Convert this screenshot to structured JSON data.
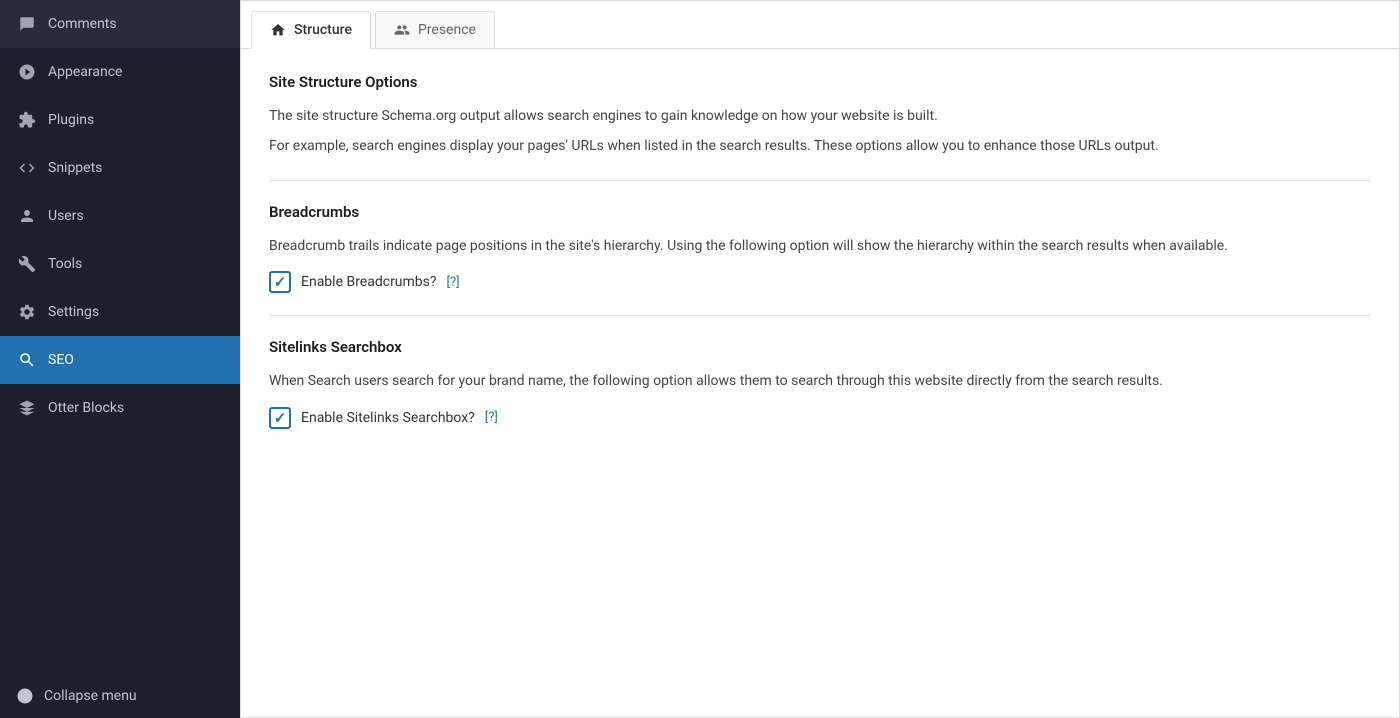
{
  "sidebar": {
    "items": [
      {
        "id": "comments",
        "label": "Comments",
        "icon": "comment"
      },
      {
        "id": "appearance",
        "label": "Appearance",
        "icon": "appearance"
      },
      {
        "id": "plugins",
        "label": "Plugins",
        "icon": "plugin"
      },
      {
        "id": "snippets",
        "label": "Snippets",
        "icon": "snippets"
      },
      {
        "id": "users",
        "label": "Users",
        "icon": "users"
      },
      {
        "id": "tools",
        "label": "Tools",
        "icon": "tools"
      },
      {
        "id": "settings",
        "label": "Settings",
        "icon": "settings"
      },
      {
        "id": "seo",
        "label": "SEO",
        "icon": "search",
        "active": true
      },
      {
        "id": "otter-blocks",
        "label": "Otter Blocks",
        "icon": "blocks"
      }
    ],
    "collapse_label": "Collapse menu"
  },
  "tabs": [
    {
      "id": "structure",
      "label": "Structure",
      "active": true
    },
    {
      "id": "presence",
      "label": "Presence",
      "active": false
    }
  ],
  "main": {
    "site_structure_options": {
      "title": "Site Structure Options",
      "desc1": "The site structure Schema.org output allows search engines to gain knowledge on how your website is built.",
      "desc2": "For example, search engines display your pages' URLs when listed in the search results. These options allow you to enhance those URLs output."
    },
    "breadcrumbs": {
      "title": "Breadcrumbs",
      "desc": "Breadcrumb trails indicate page positions in the site's hierarchy. Using the following option will show the hierarchy within the search results when available.",
      "checkbox_label": "Enable Breadcrumbs?",
      "help_link": "[?]",
      "checked": true
    },
    "sitelinks_searchbox": {
      "title": "Sitelinks Searchbox",
      "desc": "When Search users search for your brand name, the following option allows them to search through this website directly from the search results.",
      "checkbox_label": "Enable Sitelinks Searchbox?",
      "help_link": "[?]",
      "checked": true
    }
  },
  "colors": {
    "sidebar_bg": "#1e1e2d",
    "active_bg": "#2271b1",
    "text_muted": "#a0a5b0"
  }
}
